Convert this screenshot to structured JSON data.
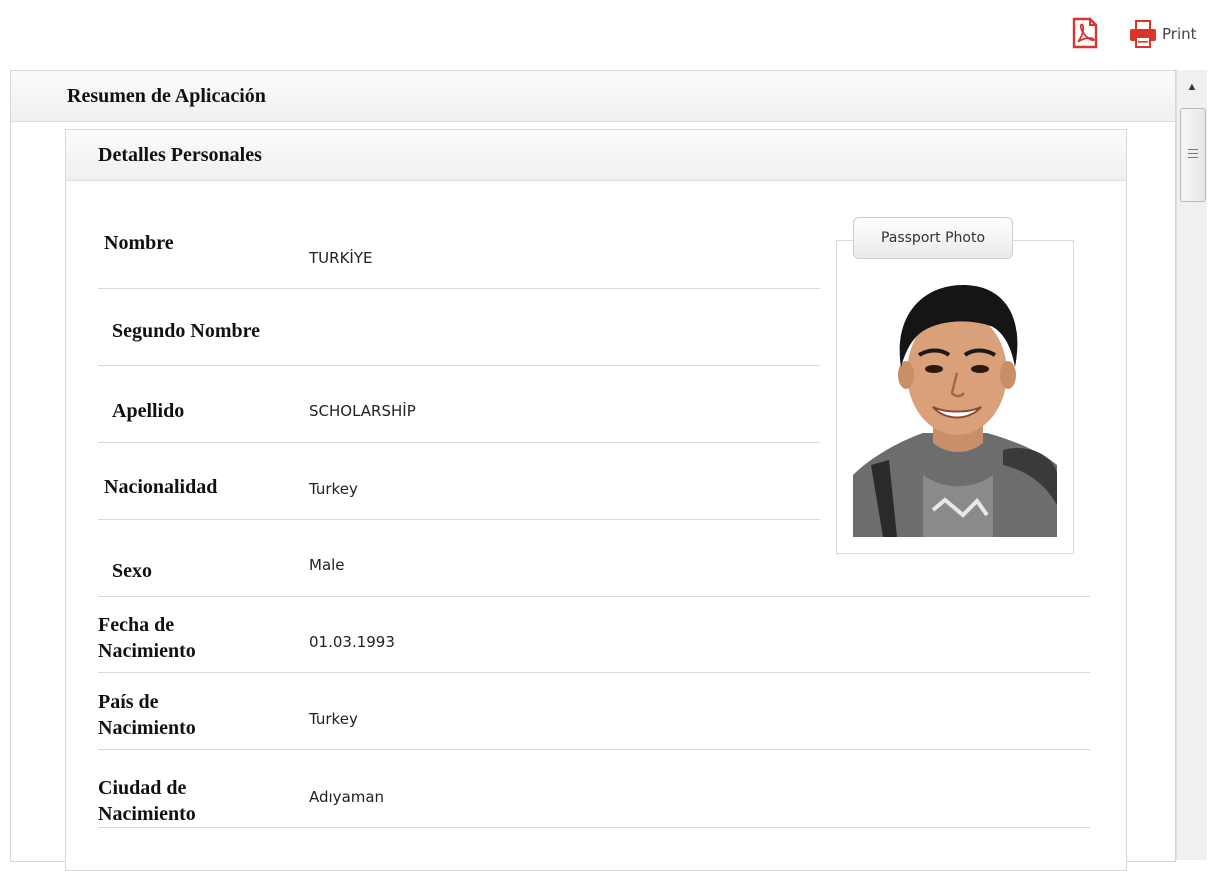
{
  "toolbar": {
    "pdf_icon": "pdf-icon",
    "print_icon": "printer-icon",
    "print_label": "Print"
  },
  "summary": {
    "title": "Resumen de Aplicación"
  },
  "personal": {
    "title": "Detalles Personales",
    "photo_label": "Passport Photo",
    "fields": [
      {
        "label": "Nombre",
        "value": "TURKİYE"
      },
      {
        "label": "Segundo Nombre",
        "value": ""
      },
      {
        "label": "Apellido",
        "value": "SCHOLARSHİP"
      },
      {
        "label": "Nacionalidad",
        "value": "Turkey"
      },
      {
        "label": "Sexo",
        "value": "Male"
      },
      {
        "label": "Fecha de Nacimiento",
        "value": "01.03.1993"
      },
      {
        "label": "País de Nacimiento",
        "value": "Turkey"
      },
      {
        "label": "Ciudad de Nacimiento",
        "value": "Adıyaman"
      }
    ]
  },
  "colors": {
    "icon_red": "#d9352a",
    "header_bg": "#f3f3f3",
    "border": "#d7d7d7"
  }
}
